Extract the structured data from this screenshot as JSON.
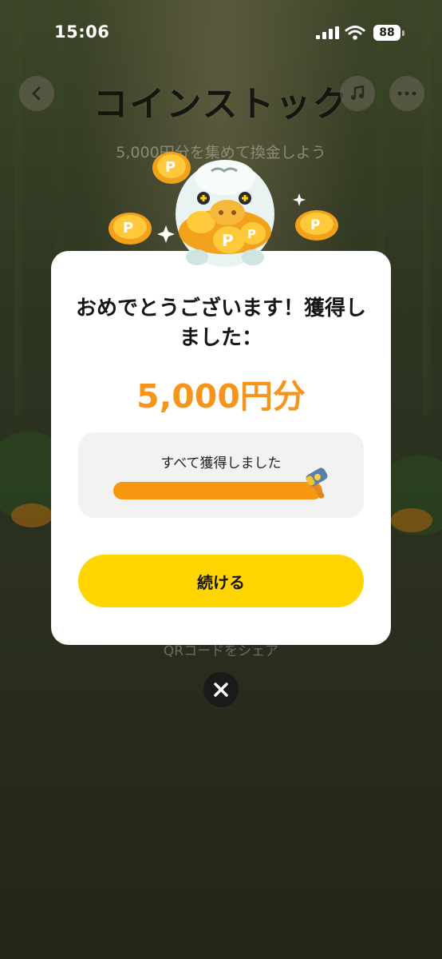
{
  "status_bar": {
    "time": "15:06",
    "battery": "88"
  },
  "header": {
    "title": "コインストック",
    "subtitle": "5,000円分を集めて換金しよう"
  },
  "background": {
    "qr_share": "QRコードをシェア"
  },
  "modal": {
    "heading": "おめでとうございます！獲得しました：",
    "amount": "5,000円分",
    "progress_label": "すべて獲得しました",
    "progress_percent": 100,
    "continue_label": "続ける"
  },
  "icons": {
    "back": "chevron-left-icon",
    "music": "music-note-icon",
    "more": "more-dots-icon",
    "close": "close-icon",
    "hammer": "hammer-icon",
    "mascot": "piggy-bank-mascot"
  },
  "colors": {
    "accent_orange": "#f7941d",
    "button_yellow": "#ffd400",
    "progress_bg": "#f2f2f2"
  }
}
